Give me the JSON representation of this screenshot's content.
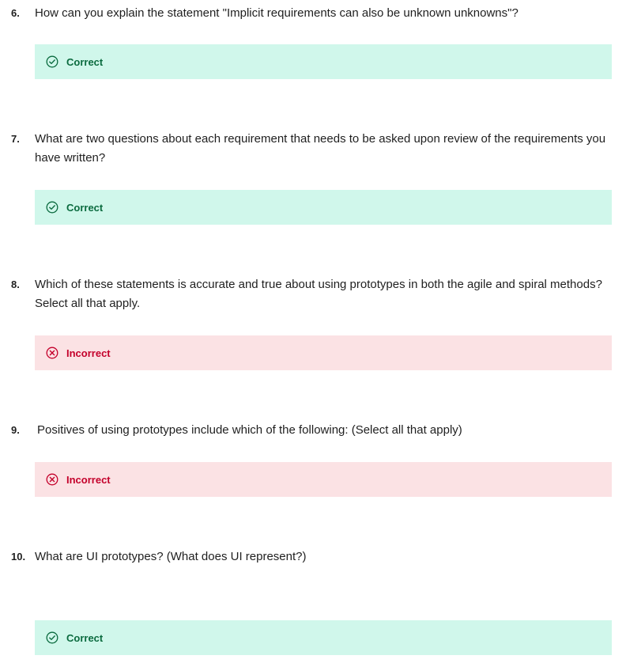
{
  "colors": {
    "correct_bg": "#d0f7eb",
    "correct_text": "#0b6b3f",
    "incorrect_bg": "#fbe2e4",
    "incorrect_text": "#c4002b"
  },
  "questions": [
    {
      "number": "6.",
      "text": "How can you explain the statement \"Implicit requirements can also be unknown unknowns\"?",
      "result": "correct",
      "result_label": "Correct",
      "icon": "check-circle-icon"
    },
    {
      "number": "7.",
      "text": "What are two questions about each requirement that needs to be asked upon review of the requirements you have written?",
      "result": "correct",
      "result_label": "Correct",
      "icon": "check-circle-icon"
    },
    {
      "number": "8.",
      "text": "Which of these statements is accurate and true about using prototypes in both the agile and spiral methods? Select all that apply.",
      "result": "incorrect",
      "result_label": "Incorrect",
      "icon": "x-circle-icon"
    },
    {
      "number": "9.",
      "text": "Positives of using prototypes include which of the following: (Select all that apply)",
      "result": "incorrect",
      "result_label": "Incorrect",
      "icon": "x-circle-icon"
    },
    {
      "number": "10.",
      "text": "What are UI prototypes? (What does UI represent?)",
      "result": "correct",
      "result_label": "Correct",
      "icon": "check-circle-icon"
    }
  ]
}
